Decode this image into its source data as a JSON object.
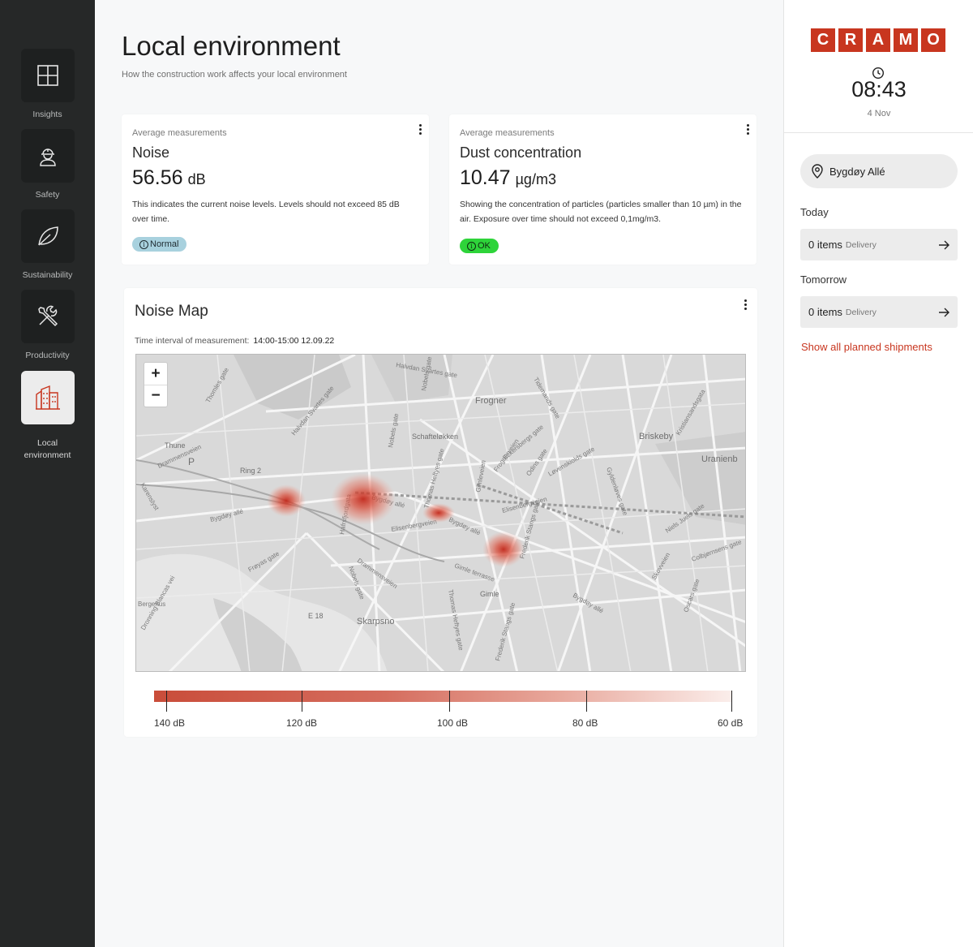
{
  "sidebar": {
    "items": [
      {
        "label": "Insights",
        "icon": "grid-icon"
      },
      {
        "label": "Safety",
        "icon": "worker-helmet-icon"
      },
      {
        "label": "Sustainability",
        "icon": "leaf-icon"
      },
      {
        "label": "Productivity",
        "icon": "tools-icon"
      },
      {
        "label": "Local environment",
        "icon": "buildings-icon",
        "active": true
      }
    ]
  },
  "header": {
    "title": "Local environment",
    "subtitle": "How the construction work affects your local environment"
  },
  "noise_card": {
    "kicker": "Average measurements",
    "title": "Noise",
    "value": "56.56",
    "unit": "dB",
    "description": "This indicates the current noise levels. Levels should not exceed 85 dB over time.",
    "badge": "Normal",
    "badge_color": "#a8d1de"
  },
  "dust_card": {
    "kicker": "Average measurements",
    "title": "Dust concentration",
    "value": "10.47",
    "unit": "µg/m3",
    "description": "Showing the concentration of particles (particles smaller than 10 µm) in the air. Exposure over time should not exceed 0,1mg/m3.",
    "badge": "OK",
    "badge_color": "#2ed43a"
  },
  "noise_map": {
    "title": "Noise Map",
    "interval_label": "Time interval of measurement:",
    "interval_value": "14:00-15:00 12.09.22",
    "zoom_in": "+",
    "zoom_out": "−",
    "place_labels": {
      "frogner": "Frogner",
      "briskeby": "Briskeby",
      "uranienborg": "Uranienb",
      "skarpsno": "Skarpsno",
      "gimle": "Gimle",
      "thune": "Thune",
      "schafteløkken": "Schafteløkken",
      "ring2": "Ring 2",
      "e18": "E 18",
      "p": "P"
    },
    "street_labels": {
      "bygdoy_alle_1": "Bygdøy allé",
      "bygdoy_alle_2": "Bygdøy allé",
      "bygdoy_alle_3": "Bygdøy allé",
      "bygdoy_alle_4": "Bygdøy allé",
      "halvdan_svartes_gate_1": "Halvdan Svartes gate",
      "halvdan_svartes_gate_2": "Halvdan Svartes gate",
      "drammensveien_1": "Drammensveien",
      "drammensveien_2": "Drammensveien",
      "thomas_heftyes_gate_1": "Thomas Heftyes gate",
      "thomas_heftyes_gate_2": "Thomas Heftyes gate",
      "frognerveien": "Frognerveien",
      "elisenbergveien_1": "Elisenbergveien",
      "elisenbergveien_2": "Elisenbergveien",
      "gimleveien": "Gimleveien",
      "gimle_terrasse": "Gimle terrasse",
      "frederik_stangs_gate_1": "Frederik Stangs gate",
      "frederik_stangs_gate_2": "Frederik Stangs gate",
      "nobels_gate_1": "Nobels gate",
      "nobels_gate_2": "Nobels gate",
      "nobels_gate_3": "Nobels gate",
      "froyas_gate": "Frøyas gate",
      "hafrsfjordgata": "Hafrsfjordgata",
      "skovveien": "Skovveien",
      "odins_gate": "Odins gate",
      "lovenskiolds_gate": "Løvenskiolds gate",
      "gyldenloves_gate": "Gyldenløves gate",
      "kristiansandsgata": "Kristiansandsgata",
      "tidemands_gate": "Tidemands gate",
      "eckersbergs_gate": "Eckersbergs gate",
      "colbjornsens_gate": "Colbjørnsens gate",
      "oscars_gate": "Oscars gate",
      "niels_juels_gate": "Niels Juels gate",
      "dronning_blancas_vei": "Dronning Blancas vei",
      "bergehus": "Bergehus",
      "karenslyst": "Karenslyst",
      "thomles_gate": "Thomles gate"
    },
    "scale": [
      {
        "label": "140 dB",
        "value": 140
      },
      {
        "label": "120 dB",
        "value": 120
      },
      {
        "label": "100 dB",
        "value": 100
      },
      {
        "label": "80 dB",
        "value": 80
      },
      {
        "label": "60 dB",
        "value": 60
      }
    ],
    "scale_colors": {
      "high": "#c94d3a",
      "low": "#fbeeeb"
    }
  },
  "right_panel": {
    "logo_letters": [
      "C",
      "R",
      "A",
      "M",
      "O"
    ],
    "logo_color": "#c8361f",
    "time": "08:43",
    "date": "4 Nov",
    "location": "Bygdøy Allé",
    "today_label": "Today",
    "today": {
      "count": "0 items",
      "kind": "Delivery"
    },
    "tomorrow_label": "Tomorrow",
    "tomorrow": {
      "count": "0 items",
      "kind": "Delivery"
    },
    "show_all": "Show all planned shipments"
  }
}
